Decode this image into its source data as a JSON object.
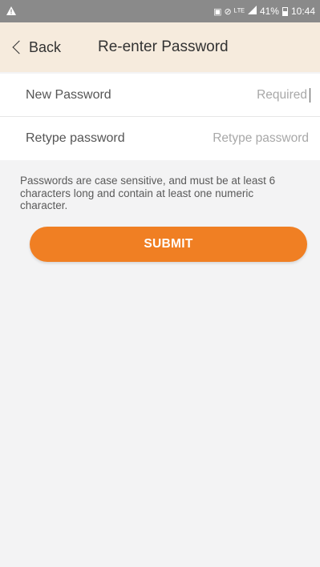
{
  "status_bar": {
    "warning_icon": "warning-triangle-icon",
    "indicators": "▣ ⊘ ᴸᵀᴱ",
    "signal_icon": "signal-icon",
    "battery_percent": "41%",
    "time": "10:44"
  },
  "nav": {
    "back_label": "Back",
    "title": "Re-enter Password"
  },
  "form": {
    "new_password": {
      "label": "New Password",
      "placeholder": "Required",
      "value": ""
    },
    "retype_password": {
      "label": "Retype password",
      "placeholder": "Retype password",
      "value": ""
    }
  },
  "hint": "Passwords are case sensitive, and must be at least 6 characters long and contain at least one numeric character.",
  "submit_label": "SUBMIT",
  "colors": {
    "accent": "#f07f23",
    "nav_bg": "#f6ebdd",
    "status_bg": "#8a8a8a",
    "page_bg": "#f3f3f4"
  }
}
